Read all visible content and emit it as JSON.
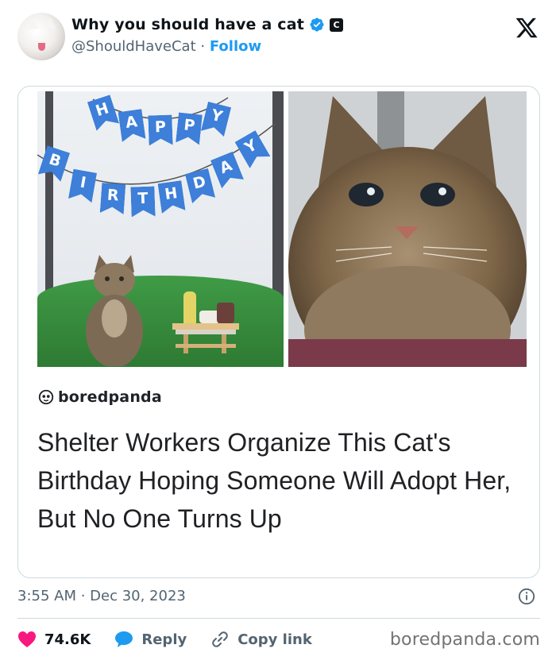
{
  "tweet": {
    "display_name": "Why you should have a cat",
    "handle": "@ShouldHaveCat",
    "separator": "·",
    "follow_label": "Follow",
    "affiliation_badge": "C",
    "timestamp": "3:55 AM · Dec 30, 2023",
    "likes": "74.6K",
    "reply_label": "Reply",
    "copy_link_label": "Copy link"
  },
  "card": {
    "banner_letters_top": [
      "H",
      "A",
      "P",
      "P",
      "Y"
    ],
    "banner_letters_bottom": [
      "B",
      "I",
      "R",
      "T",
      "H",
      "D",
      "A",
      "Y"
    ],
    "source_name": "boredpanda",
    "headline": "Shelter Workers Organize This Cat's Birthday Hoping Someone Will Adopt Her, But No One Turns Up"
  },
  "watermark": "boredpanda.com",
  "colors": {
    "like": "#f91880",
    "reply": "#1d9bf0",
    "verified": "#1d9bf0",
    "banner": "#3d7fd9"
  },
  "icons": [
    "avatar",
    "verified-badge-icon",
    "affiliation-badge",
    "x-logo-icon",
    "info-icon",
    "heart-icon",
    "reply-bubble-icon",
    "link-icon",
    "boredpanda-logo-icon"
  ]
}
